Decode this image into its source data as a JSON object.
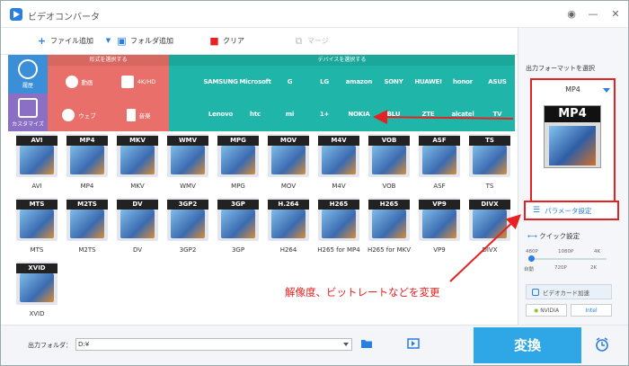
{
  "app": {
    "title": "ビデオコンバータ",
    "minimize": "—",
    "close": "✕",
    "pin": "◉"
  },
  "toolbar": {
    "add_file": "ファイル追加",
    "add_folder": "フォルダ追加",
    "clear": "クリア",
    "merge": "マージ"
  },
  "categories": {
    "history": "履歴",
    "custom": "カスタマイズ",
    "format_header": "形式を選択する",
    "device_header": "デバイスを選択する",
    "format_items": [
      {
        "label": "動画"
      },
      {
        "label": "4K/HD"
      },
      {
        "label": "ウェブ"
      },
      {
        "label": "音楽"
      }
    ],
    "brands_row1": [
      "",
      "SAMSUNG",
      "Microsoft",
      "G",
      "LG",
      "amazon",
      "SONY",
      "HUAWEI",
      "honor",
      "ASUS"
    ],
    "brands_row2": [
      "",
      "Lenovo",
      "htc",
      "mi",
      "1+",
      "NOKIA",
      "BLU",
      "ZTE",
      "alcatel",
      "TV"
    ]
  },
  "formats": [
    {
      "name": "AVI",
      "label": "AVI"
    },
    {
      "name": "MP4",
      "label": "MP4"
    },
    {
      "name": "MKV",
      "label": "MKV"
    },
    {
      "name": "WMV",
      "label": "WMV"
    },
    {
      "name": "MPG",
      "label": "MPG"
    },
    {
      "name": "MOV",
      "label": "MOV"
    },
    {
      "name": "M4V",
      "label": "M4V"
    },
    {
      "name": "VOB",
      "label": "VOB"
    },
    {
      "name": "ASF",
      "label": "ASF"
    },
    {
      "name": "TS",
      "label": "TS"
    },
    {
      "name": "MTS",
      "label": "MTS"
    },
    {
      "name": "M2TS",
      "label": "M2TS"
    },
    {
      "name": "DV",
      "label": "DV"
    },
    {
      "name": "3GP2",
      "label": "3GP2"
    },
    {
      "name": "3GP",
      "label": "3GP"
    },
    {
      "name": "H.264",
      "label": "H264"
    },
    {
      "name": "H265",
      "label": "H265 for MP4"
    },
    {
      "name": "H265",
      "label": "H265 for MKV"
    },
    {
      "name": "VP9",
      "label": "VP9"
    },
    {
      "name": "DIVX",
      "label": "DIVX"
    },
    {
      "name": "XVID",
      "label": "XVID"
    }
  ],
  "right": {
    "output_format_header": "出力フォーマットを選択",
    "selected_format": "MP4",
    "big_icon": "MP4",
    "param_button": "パラメータ設定",
    "quick_setting": "クイック設定",
    "slider_top": [
      "480P",
      "1080P",
      "4K"
    ],
    "slider_bottom": [
      "自動",
      "720P",
      "2K"
    ],
    "slider_level": 0,
    "gpu_accel": "ビデオカード加速",
    "vendors": [
      "NVIDIA",
      "Intel"
    ]
  },
  "bottom": {
    "output_folder_label": "出力フォルダ：",
    "output_path": "D:¥",
    "convert": "変換"
  },
  "annotation": "解像度、ビットレートなどを変更",
  "colors": {
    "accent": "#2a7de1",
    "red": "#e52121",
    "format_panel": "#e9706a",
    "device_panel": "#1fb6a9",
    "convert": "#2fa7e6"
  }
}
